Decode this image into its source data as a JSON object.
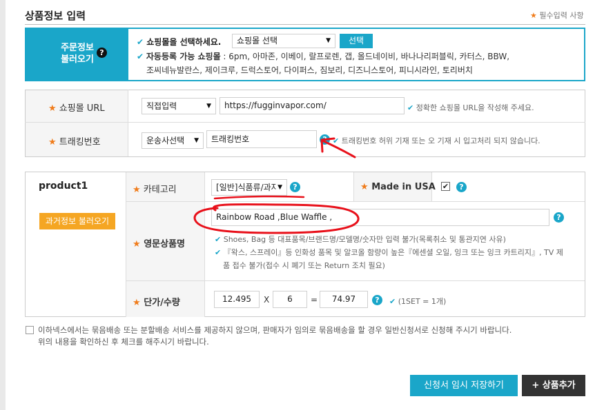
{
  "header": {
    "title": "상품정보 입력",
    "required_note": "필수입력 사항"
  },
  "order_import": {
    "label_line1": "주문정보",
    "label_line2": "불러오기",
    "select_prompt": "쇼핑몰을 선택하세요.",
    "mall_select_value": "쇼핑몰 선택",
    "select_button": "선택",
    "auto_label": "자동등록 가능 쇼핑몰",
    "auto_list_line1": " : 6pm, 아마존, 이베이, 랄프로렌, 갭, 올드네이비, 바나나리퍼블릭, 카터스, BBW,",
    "auto_list_line2": "조씨네뉴발란스, 제이크루, 드럭스토어, 다이퍼스, 짐보리, 디즈니스토어, 피니시라인, 토리버치"
  },
  "mall_url": {
    "label": "쇼핑몰 URL",
    "method_select": "직접입력",
    "url_value": "https://fugginvapor.com/",
    "hint": "정확한 쇼핑몰 URL을 작성해 주세요."
  },
  "tracking": {
    "label": "트래킹번호",
    "carrier_select": "운송사선택",
    "tracking_value": "트래킹번호",
    "hint": "트래킹번호 허위 기재 또는 오 기재 시 입고처리 되지 않습니다."
  },
  "product": {
    "name": "product1",
    "past_info_button": "과거정보 불러오기",
    "category_label": "카테고리",
    "category_value": "[일반]식품류/과자",
    "made_in_usa_label": "Made in USA",
    "eng_name_label": "영문상품명",
    "eng_name_value": "Rainbow Road ,Blue Waffle ,",
    "eng_name_hint1": "Shoes, Bag 등 대표품목/브랜드명/모델명/숫자만 입력 불가(목록취소 및 통관지연 사유)",
    "eng_name_hint2a": "『왁스, 스프레이』등 인화성 품목 및 알코올 함량이 높은『에센셜 오일, 잉크 또는 잉크 카트리지』, TV 제",
    "eng_name_hint2b": "품 접수 불가(접수 시 폐기 또는 Return 조치 필요)",
    "price_label": "단가/수량",
    "unit_price": "12.495",
    "times_sign": "X",
    "quantity": "6",
    "equals_sign": "=",
    "total": "74.97",
    "set_hint": "(1SET = 1개)"
  },
  "agreement": {
    "text_line1": "이하넥스에서는 묶음배송 또는 분할배송 서비스를 제공하지 않으며, 판매자가 임의로 묶음배송을 할 경우 일반신청서로 신청해 주시기 바랍니다.",
    "text_line2": "위의 내용을 확인하신 후 체크를 해주시기 바랍니다."
  },
  "footer": {
    "save_button": "신청서 임시 저장하기",
    "add_product_button": "+ 상품추가"
  },
  "colors": {
    "accent": "#1aa6c9",
    "star": "#f07c1b",
    "button_orange": "#f5a623",
    "dark_button": "#333333",
    "annotation_red": "#e8101a"
  }
}
